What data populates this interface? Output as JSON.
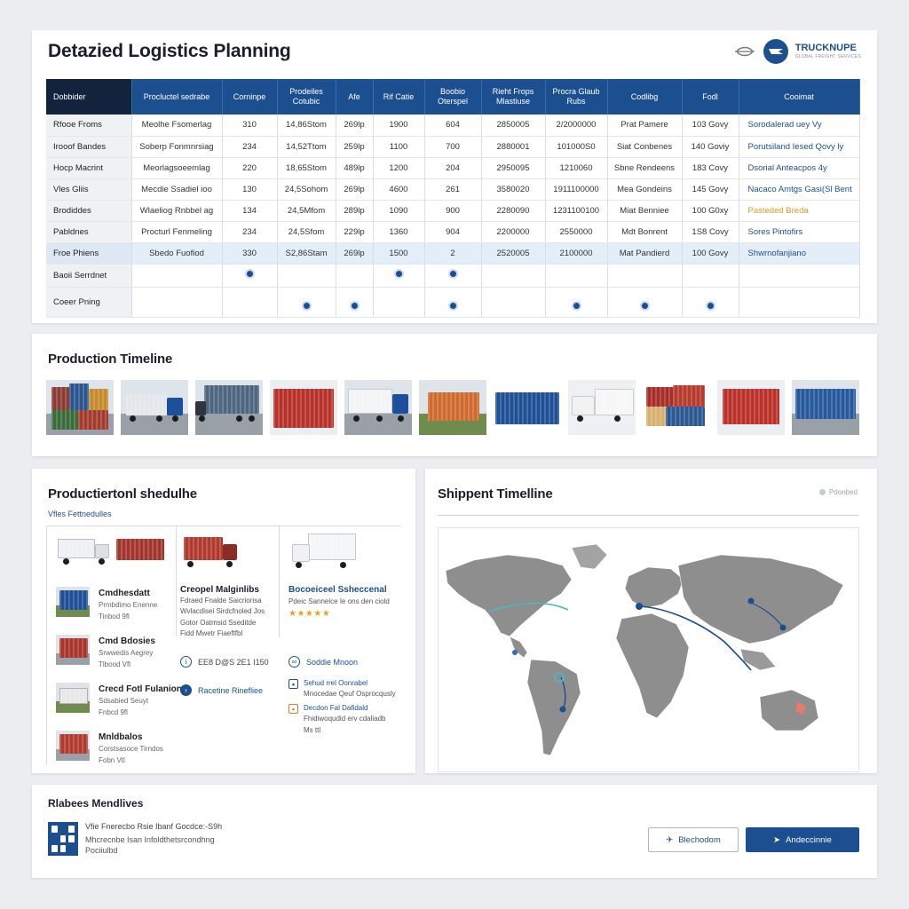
{
  "header": {
    "title": "Detazied Logistics Planning",
    "brand_name": "TRUCKNUPE",
    "brand_tagline": "GLOBAL FREIGHT SERVICES"
  },
  "grid": {
    "columns": [
      "Dobbider",
      "Procluctel sedrabe",
      "Corninpe",
      "Prodeiles Cotubic",
      "Afe",
      "Rif Catie",
      "Boobio Oterspel",
      "Rieht Frops Mlastiuse",
      "Procra Glaub Rubs",
      "Codlibg",
      "Fodl",
      "Cooimat"
    ],
    "rows": [
      [
        "Rfooe Froms",
        "Meolhe Fsomerlag",
        "310",
        "14,86Stom",
        "269lp",
        "1900",
        "604",
        "2850005",
        "2/2000000",
        "Prat Pamere",
        "103 Govy",
        "Sorodalerad uey Vy"
      ],
      [
        "Irooof Bandes",
        "Soberp Fonmnrsiag",
        "234",
        "14,52Ttom",
        "259lp",
        "1100",
        "700",
        "2880001",
        "101000S0",
        "Siat Conbenes",
        "140 Goviy",
        "Porutsiland Iesed Qovy ly"
      ],
      [
        "Hocp Macrint",
        "Meorlagsoeemlag",
        "220",
        "18,65Stom",
        "489lp",
        "1200",
        "204",
        "2950095",
        "1210060",
        "Sbne Rendeens",
        "183 Covy",
        "Dsorial Anteacpos 4y"
      ],
      [
        "Vles Gliis",
        "Mecdie Ssadiel ioo",
        "130",
        "24,5Sohom",
        "269lp",
        "4600",
        "261",
        "3580020",
        "1911100000",
        "Mea Gondeins",
        "145 Govy",
        "Nacaco Amtgs Gasi(Sl Bent"
      ],
      [
        "Brodiddes",
        "Wlaeliog Rnbbel ag",
        "134",
        "24,5Mfom",
        "289lp",
        "1090",
        "900",
        "2280090",
        "1231100100",
        "Miat Benniee",
        "100 G0xy",
        "Pasteded Breda"
      ],
      [
        "Pabldnes",
        "Procturl Fenmeling",
        "234",
        "24,5Sfom",
        "229lp",
        "1360",
        "904",
        "2200000",
        "2550000",
        "Mdt Bonrent",
        "1S8 Covy",
        "Sores Pintofirs"
      ],
      [
        "Froe Phiens",
        "Sbedo Fuofiod",
        "330",
        "S2,86Stam",
        "269lp",
        "1500",
        "2",
        "2520005",
        "2100000",
        "Mat Pandierd",
        "100 Govy",
        "Shwrnofanjiano"
      ]
    ],
    "marker_rows": [
      "Baoii Serrdnet",
      "Coeer Pning"
    ]
  },
  "timeline": {
    "title": "Production Timeline"
  },
  "schedule": {
    "title": "Productiertonl shedulhe",
    "subtitle": "Vfles Fettnedulles",
    "info_card": {
      "title": "Creopel Malginlibs",
      "lines": [
        "Fdraed Fnalde Saicriorisa",
        "Wvlacdisei Sirdcfnoled Jos",
        "Gotor Oatmsid Sseditde",
        "Fidd Mwetr Fiaeftfbl"
      ]
    },
    "feature_card": {
      "title": "Bocoeiceel Ssheccenal",
      "line": "Pdeic Sannelce Ie ons den ciold",
      "stars": "★★★★★"
    },
    "items": [
      {
        "title": "Cmdhesdatt",
        "desc": [
          "Prmbdimo Enenne",
          "Tinbod 9fl"
        ]
      },
      {
        "title": "Cmd Bdosies",
        "desc": [
          "Srwwedis Aegrey",
          "Tlbood Vfl"
        ]
      },
      {
        "title": "Crecd Fotl Fulanion",
        "desc": [
          "Sdsabied Seuyt",
          "Fnbcd 9fl"
        ]
      },
      {
        "title": "Mnldbalos",
        "desc": [
          "Corstsasoce Tirndos",
          "Fobn Vtl"
        ]
      }
    ],
    "badges": [
      {
        "text": "EE8 D@S 2E1 I150"
      },
      {
        "text": "Racetine Rinefliee"
      }
    ],
    "right_badges": [
      {
        "text": "Soddie Mnoon"
      }
    ],
    "details": [
      {
        "title": "Sehud rrel Oonrabel",
        "desc": "Mnocedae Qeuf Osprocqusly"
      },
      {
        "title": "Decdon Fal Dafidald",
        "desc": "Fhidiwoqudid erv cdaliadb"
      }
    ],
    "details_foot": "Ms ttl"
  },
  "shipment": {
    "title": "Shippent Timelline",
    "status": "Pdonbed"
  },
  "footer": {
    "title": "Rlabees Mendlives",
    "line1": "Vfie Fnerecbo Rsie Ibanf Gocdce:-S9h",
    "line2": [
      "Mhcrecnbe Isan Infoldthetsrcondhng",
      "Pociiulbd"
    ],
    "secondary_button": "Blechodom",
    "primary_button": "Andeccinnie"
  },
  "colors": {
    "primary": "#1b4f8f",
    "header_dark": "#13223d",
    "highlight_row": "#e4eef8",
    "accent": "#e09a24"
  }
}
